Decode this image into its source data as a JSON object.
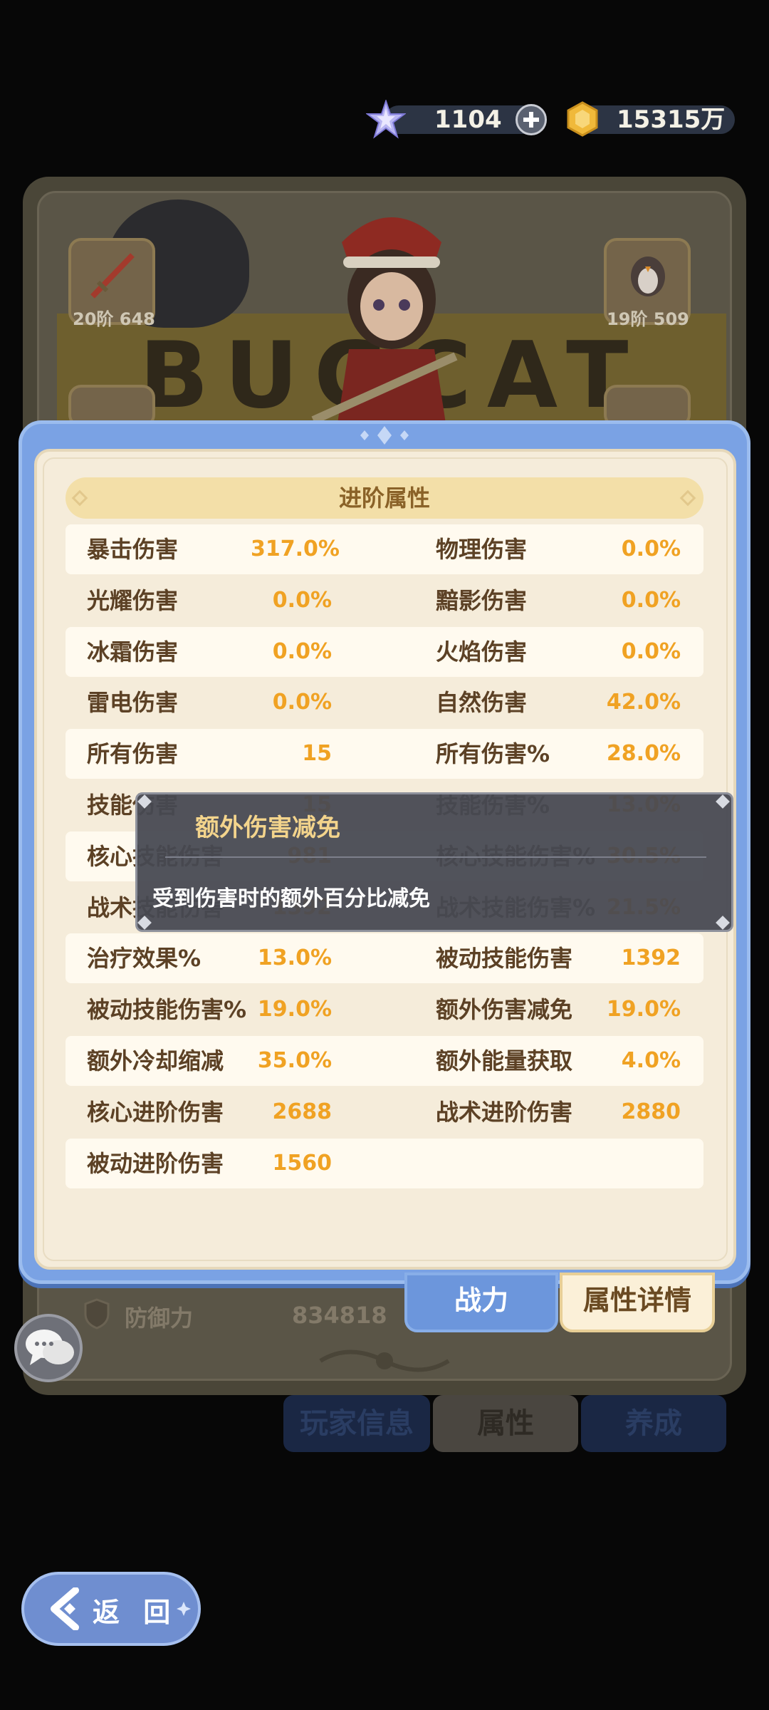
{
  "currency": {
    "gems": "1104",
    "gold": "15315万"
  },
  "background": {
    "banner_text": "BUGCAT CAPOO",
    "equip_left_top": "20阶 648",
    "equip_right_top": "19阶 509",
    "defense_label": "防御力",
    "defense_value": "834818",
    "tabs": [
      "玩家信息",
      "属性",
      "养成"
    ]
  },
  "popup": {
    "header": "进阶属性",
    "rows": [
      {
        "l1": "暴击伤害",
        "v1": "317.0%",
        "l2": "物理伤害",
        "v2": "0.0%"
      },
      {
        "l1": "光耀伤害",
        "v1": "0.0%",
        "l2": "黯影伤害",
        "v2": "0.0%"
      },
      {
        "l1": "冰霜伤害",
        "v1": "0.0%",
        "l2": "火焰伤害",
        "v2": "0.0%"
      },
      {
        "l1": "雷电伤害",
        "v1": "0.0%",
        "l2": "自然伤害",
        "v2": "42.0%"
      },
      {
        "l1": "所有伤害",
        "v1": "15",
        "l2": "所有伤害%",
        "v2": "28.0%"
      },
      {
        "l1": "技能伤害",
        "v1": "15",
        "l2": "技能伤害%",
        "v2": "13.0%"
      },
      {
        "l1": "核心技能伤害",
        "v1": "981",
        "l2": "核心技能伤害%",
        "v2": "30.5%"
      },
      {
        "l1": "战术技能伤害",
        "v1": "1392",
        "l2": "战术技能伤害%",
        "v2": "21.5%"
      },
      {
        "l1": "治疗效果%",
        "v1": "13.0%",
        "l2": "被动技能伤害",
        "v2": "1392"
      },
      {
        "l1": "被动技能伤害%",
        "v1": "19.0%",
        "l2": "额外伤害减免",
        "v2": "19.0%"
      },
      {
        "l1": "额外冷却缩减",
        "v1": "35.0%",
        "l2": "额外能量获取",
        "v2": "4.0%"
      },
      {
        "l1": "核心进阶伤害",
        "v1": "2688",
        "l2": "战术进阶伤害",
        "v2": "2880"
      },
      {
        "l1": "被动进阶伤害",
        "v1": "1560",
        "l2": "",
        "v2": ""
      }
    ],
    "tab_power": "战力",
    "tab_detail": "属性详情"
  },
  "tooltip": {
    "title": "额外伤害减免",
    "description": "受到伤害时的额外百分比减免"
  },
  "back_button": "返 回"
}
